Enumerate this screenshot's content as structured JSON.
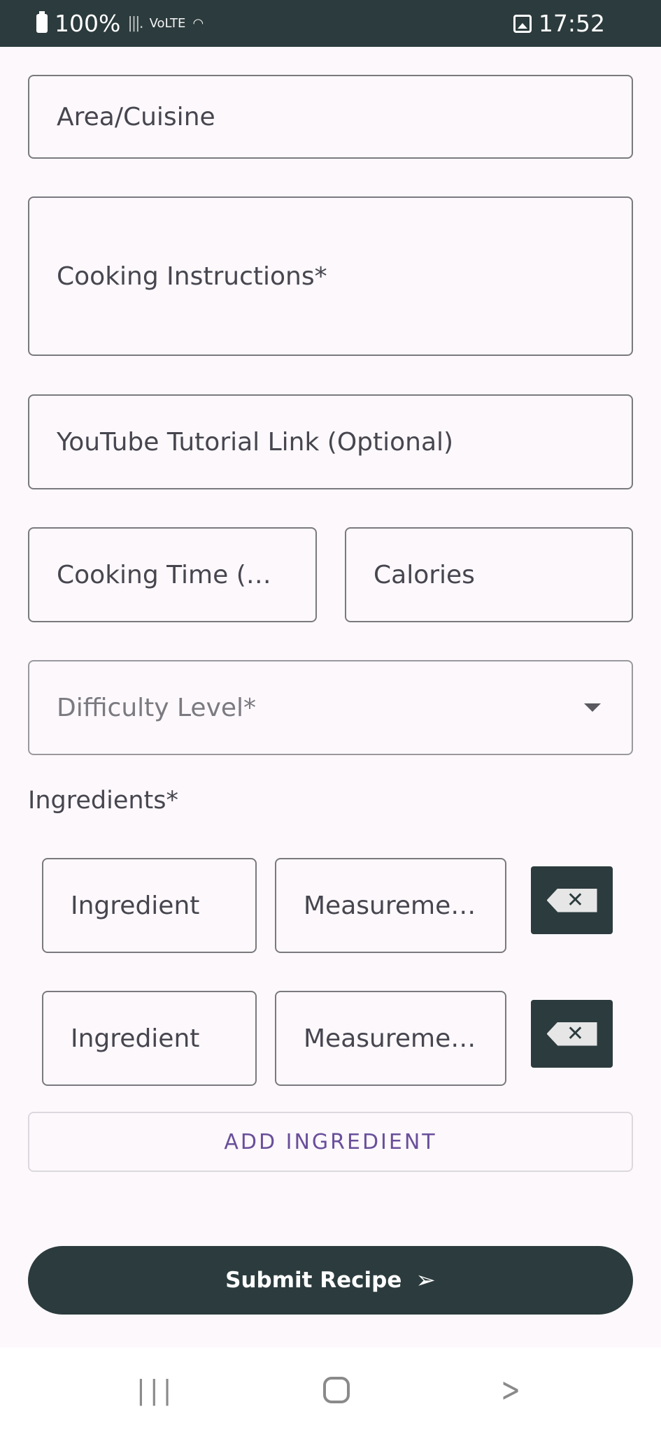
{
  "status_bar": {
    "battery": "100%",
    "network": "VoLTE",
    "time": "17:52"
  },
  "form": {
    "area_cuisine_placeholder": "Area/Cuisine",
    "instructions_placeholder": "Cooking Instructions*",
    "youtube_placeholder": "YouTube Tutorial Link (Optional)",
    "cooking_time_placeholder": "Cooking Time (…",
    "calories_placeholder": "Calories",
    "difficulty_placeholder": "Difficulty Level*",
    "ingredients_label": "Ingredients*",
    "ingredients": [
      {
        "name_placeholder": "Ingredient",
        "measurement_placeholder": "Measureme…"
      },
      {
        "name_placeholder": "Ingredient",
        "measurement_placeholder": "Measureme…"
      }
    ],
    "add_ingredient_label": "ADD INGREDIENT",
    "submit_label": "Submit Recipe"
  },
  "icons": {
    "delete": "backspace-icon",
    "submit": "send-icon",
    "dropdown": "arrow-drop-down-icon"
  },
  "colors": {
    "primary": "#2c3b3d",
    "accent": "#6a4f9a",
    "background": "#fcf8fc"
  }
}
